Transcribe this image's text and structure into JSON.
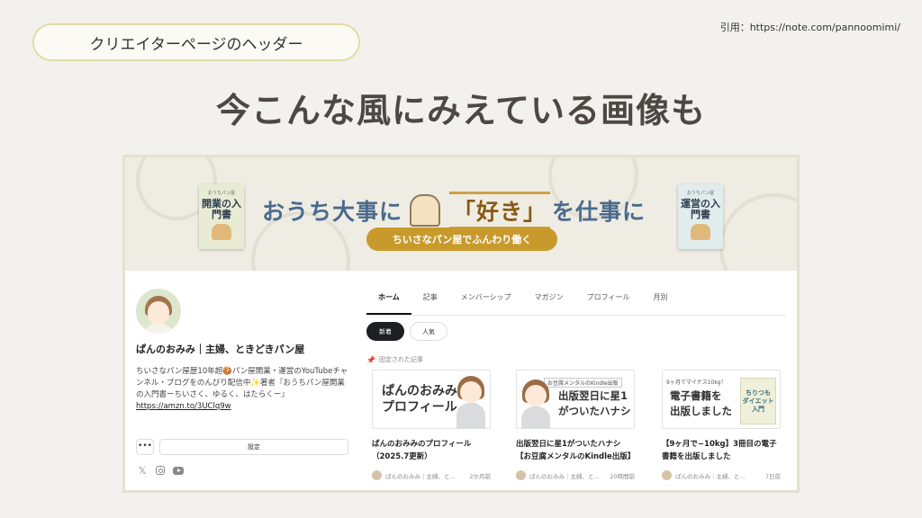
{
  "slide": {
    "label": "クリエイターページのヘッダー",
    "citation": "引用：https://note.com/pannoomimi/",
    "headline": "今こんな風にみえている画像も"
  },
  "banner": {
    "title_pre": "おうち大事に",
    "title_suki": "「好き」",
    "title_post": "を仕事に",
    "subtitle": "ちいさなパン屋でふんわり働く",
    "book_left": {
      "kicker": "おうちパン屋",
      "title": "開業の入門書"
    },
    "book_right": {
      "kicker": "おうちパン屋",
      "title": "運営の入門書"
    }
  },
  "profile": {
    "name": "ぱんのおみみ｜主婦、ときどきパン屋",
    "bio": "ちいさなパン屋歴10年超🍪パン屋開業・運営のYouTubeチャンネル・ブログをのんびり配信中✨著者『おうちパン屋開業の入門書ーちいさく、ゆるく、はたらくー』",
    "link": "https://amzn.to/3UClq9w",
    "more_label": "•••",
    "settings_label": "設定",
    "social_x": "𝕏"
  },
  "tabs": [
    "ホーム",
    "記事",
    "メンバーシップ",
    "マガジン",
    "プロフィール",
    "月別"
  ],
  "active_tab": "ホーム",
  "chips": [
    "新着",
    "人気"
  ],
  "pinned_label": "固定された記事",
  "cards": [
    {
      "thumb_text": "ぱんのおみみ\nプロフィール",
      "title": "ぱんのおみみのプロフィール（2025.7更新）",
      "author": "ぱんのおみみ｜主婦、と...",
      "time": "2か月前"
    },
    {
      "thumb_tag": "お豆腐メンタルのKindle出版",
      "thumb_text": "出版翌日に星1\nがついたハナシ",
      "title": "出版翌日に星1がついたハナシ【お豆腐メンタルのKindle出版】",
      "author": "ぱんのおみみ｜主婦、と...",
      "time": "20時間前"
    },
    {
      "thumb_tag": "9ヶ月でマイナス10kg！",
      "thumb_text": "電子書籍を\n出版しました",
      "thumb_book": "ちりつも\nダイエット\n入門",
      "title": "【9ヶ月で−10kg】3冊目の電子書籍を出版しました",
      "author": "ぱんのおみみ｜主婦、と...",
      "time": "7日前"
    }
  ],
  "colors": {
    "pill_border": "#e2dca6",
    "headline": "#4e4845",
    "banner_title": "#4a6b8f",
    "banner_sub": "#c89a2b",
    "chip_active": "#1d1f22"
  },
  "icons": [
    "pin-icon",
    "x-icon",
    "instagram-icon",
    "youtube-icon",
    "more-icon"
  ]
}
